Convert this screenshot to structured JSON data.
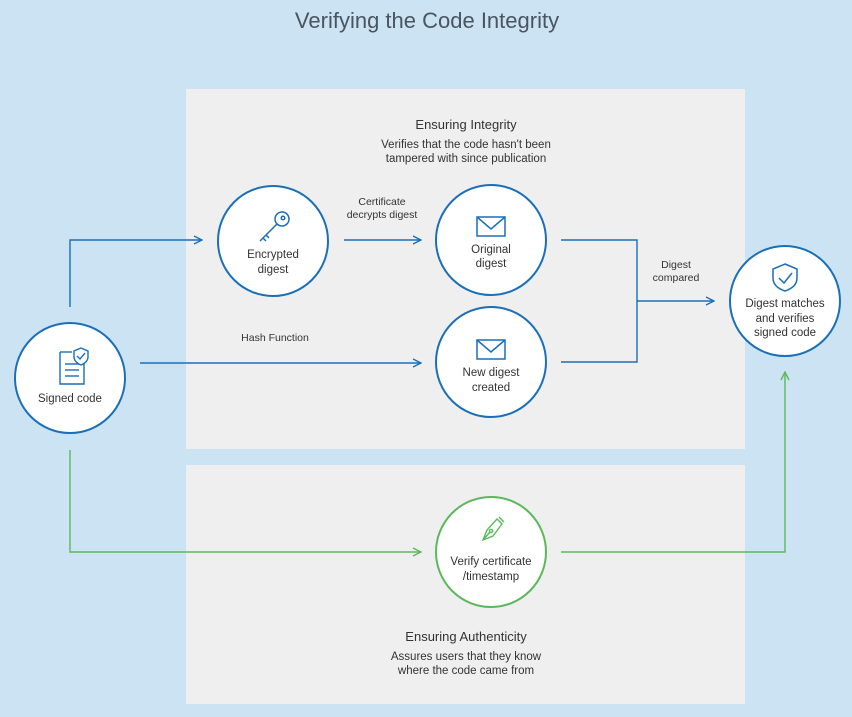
{
  "title": "Verifying the Code Integrity",
  "colors": {
    "background": "#cce3f3",
    "panel": "#efefef",
    "blue": "#1a6fb8",
    "green": "#5cb85c",
    "text": "#333333",
    "title_text": "#4a5560"
  },
  "integrity_panel": {
    "heading": "Ensuring Integrity",
    "desc_line1": "Verifies that the code hasn't been",
    "desc_line2": "tampered with since publication"
  },
  "authenticity_panel": {
    "heading": "Ensuring Authenticity",
    "desc_line1": "Assures users that they know",
    "desc_line2": "where the code came from"
  },
  "nodes": {
    "signed_code": {
      "line1": "Signed code",
      "icon": "document-shield-icon"
    },
    "encrypted_digest": {
      "line1": "Encrypted",
      "line2": "digest",
      "icon": "key-icon"
    },
    "original_digest": {
      "line1": "Original",
      "line2": "digest",
      "icon": "envelope-icon"
    },
    "new_digest": {
      "line1": "New digest",
      "line2": "created",
      "icon": "envelope-icon"
    },
    "verify_cert": {
      "line1": "Verify certificate",
      "line2": "/timestamp",
      "icon": "pen-nib-icon"
    },
    "digest_matches": {
      "line1": "Digest matches",
      "line2": "and verifies",
      "line3": "signed code",
      "icon": "shield-check-icon"
    }
  },
  "edge_labels": {
    "cert_line1": "Certificate",
    "cert_line2": "decrypts digest",
    "hash": "Hash Function",
    "compared_line1": "Digest",
    "compared_line2": "compared"
  }
}
